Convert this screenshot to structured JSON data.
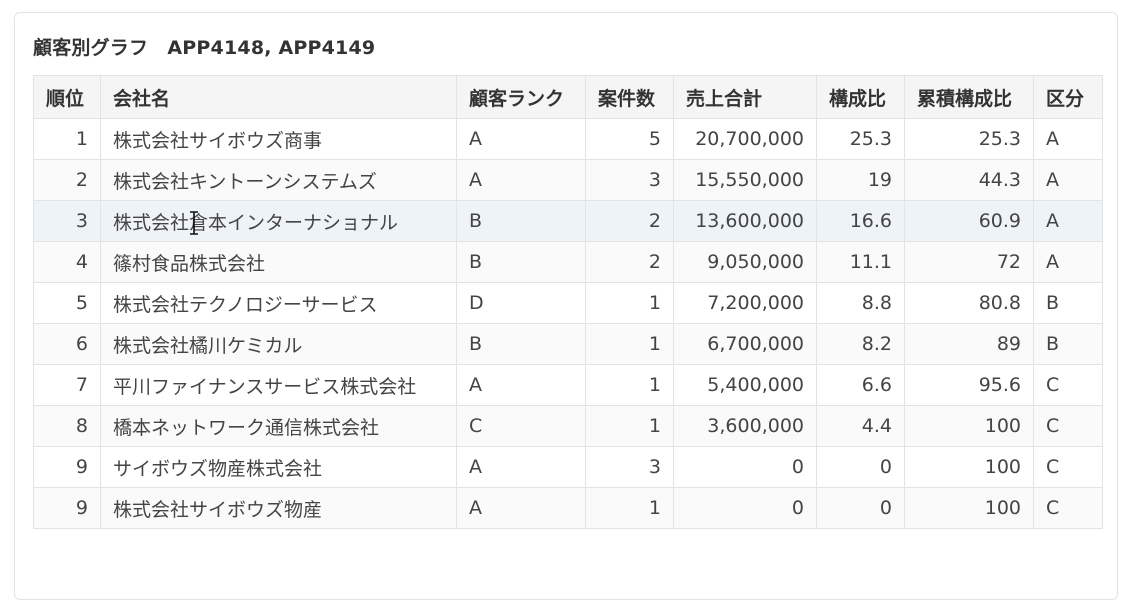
{
  "report": {
    "title": "顧客別グラフ　APP4148, APP4149"
  },
  "table": {
    "columns": [
      "順位",
      "会社名",
      "顧客ランク",
      "案件数",
      "売上合計",
      "構成比",
      "累積構成比",
      "区分"
    ],
    "rows": [
      {
        "rank": "1",
        "company": "株式会社サイボウズ商事",
        "customer_rank": "A",
        "deals": "5",
        "sales_total": "20,700,000",
        "ratio": "25.3",
        "cumulative_ratio": "25.3",
        "category": "A"
      },
      {
        "rank": "2",
        "company": "株式会社キントーンシステムズ",
        "customer_rank": "A",
        "deals": "3",
        "sales_total": "15,550,000",
        "ratio": "19",
        "cumulative_ratio": "44.3",
        "category": "A"
      },
      {
        "rank": "3",
        "company": "株式会社倉本インターナショナル",
        "customer_rank": "B",
        "deals": "2",
        "sales_total": "13,600,000",
        "ratio": "16.6",
        "cumulative_ratio": "60.9",
        "category": "A"
      },
      {
        "rank": "4",
        "company": "篠村食品株式会社",
        "customer_rank": "B",
        "deals": "2",
        "sales_total": "9,050,000",
        "ratio": "11.1",
        "cumulative_ratio": "72",
        "category": "A"
      },
      {
        "rank": "5",
        "company": "株式会社テクノロジーサービス",
        "customer_rank": "D",
        "deals": "1",
        "sales_total": "7,200,000",
        "ratio": "8.8",
        "cumulative_ratio": "80.8",
        "category": "B"
      },
      {
        "rank": "6",
        "company": "株式会社橘川ケミカル",
        "customer_rank": "B",
        "deals": "1",
        "sales_total": "6,700,000",
        "ratio": "8.2",
        "cumulative_ratio": "89",
        "category": "B"
      },
      {
        "rank": "7",
        "company": "平川ファイナンスサービス株式会社",
        "customer_rank": "A",
        "deals": "1",
        "sales_total": "5,400,000",
        "ratio": "6.6",
        "cumulative_ratio": "95.6",
        "category": "C"
      },
      {
        "rank": "8",
        "company": "橋本ネットワーク通信株式会社",
        "customer_rank": "C",
        "deals": "1",
        "sales_total": "3,600,000",
        "ratio": "4.4",
        "cumulative_ratio": "100",
        "category": "C"
      },
      {
        "rank": "9",
        "company": "サイボウズ物産株式会社",
        "customer_rank": "A",
        "deals": "3",
        "sales_total": "0",
        "ratio": "0",
        "cumulative_ratio": "100",
        "category": "C"
      },
      {
        "rank": "9",
        "company": "株式会社サイボウズ物産",
        "customer_rank": "A",
        "deals": "1",
        "sales_total": "0",
        "ratio": "0",
        "cumulative_ratio": "100",
        "category": "C"
      }
    ]
  },
  "colors": {
    "header_bg": "#f5f5f5",
    "border": "#e3e3e3",
    "hover_row": "#eef3f8",
    "text": "#333333"
  }
}
